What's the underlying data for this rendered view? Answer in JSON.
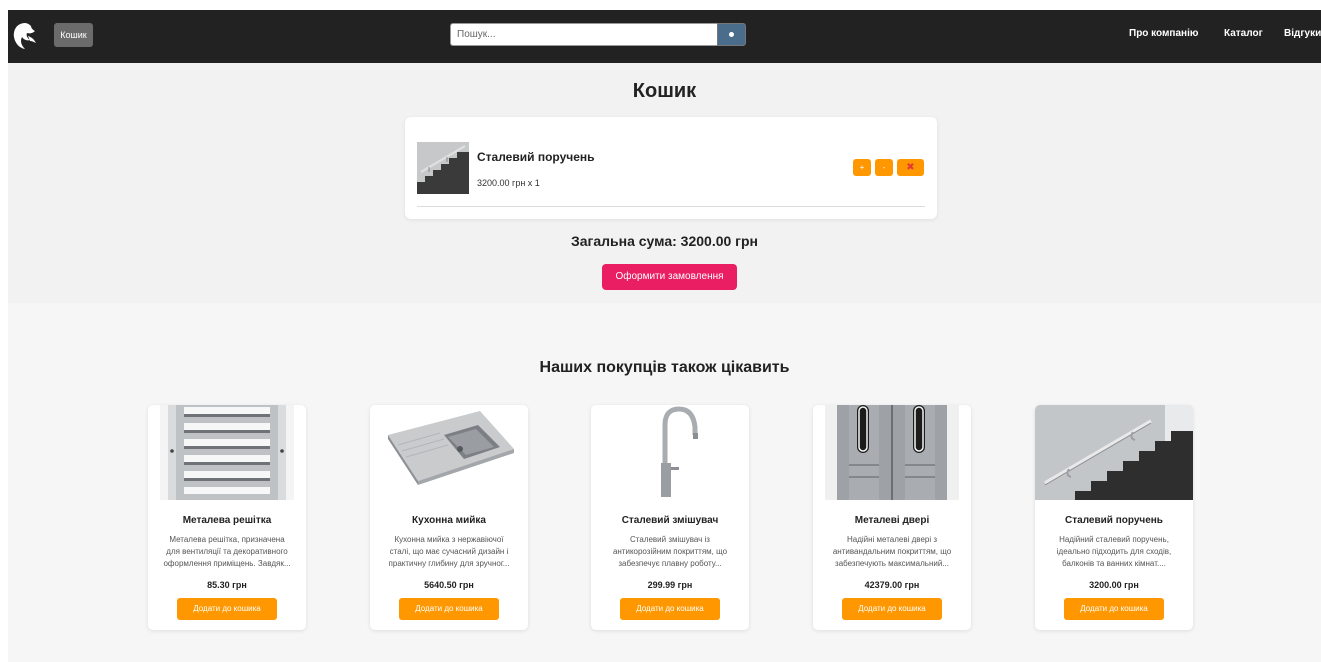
{
  "header": {
    "cart_button": "Кошик",
    "search_placeholder": "Пошук...",
    "nav": [
      "Про компанію",
      "Каталог",
      "Відгуки"
    ]
  },
  "cart": {
    "title": "Кошик",
    "items": [
      {
        "name": "Сталевий поручень",
        "price_line": "3200.00 грн x 1",
        "plus": "+",
        "minus": "-",
        "remove": "✖"
      }
    ],
    "total": "Загальна сума: 3200.00 грн",
    "order_button": "Оформити замовлення"
  },
  "recommendations": {
    "title": "Наших покупців також цікавить",
    "add_label": "Додати до кошика",
    "products": [
      {
        "name": "Металева решітка",
        "desc": "Металева решітка, призначена для вентиляції та декоративного оформлення приміщень. Завдяк...",
        "price": "85.30 грн"
      },
      {
        "name": "Кухонна мийка",
        "desc": "Кухонна мийка з нержавіючої сталі, що має сучасний дизайн і практичну глибину для зручног...",
        "price": "5640.50 грн"
      },
      {
        "name": "Сталевий змішувач",
        "desc": "Сталевий змішувач із антикорозійним покриттям, що забезпечує плавну роботу...",
        "price": "299.99 грн"
      },
      {
        "name": "Металеві двері",
        "desc": "Надійні металеві двері з антивандальним покриттям, що забезпечують максимальний...",
        "price": "42379.00 грн"
      },
      {
        "name": "Сталевий поручень",
        "desc": "Надійний сталевий поручень, ідеально підходить для сходів, балконів та ванних кімнат....",
        "price": "3200.00 грн"
      }
    ]
  },
  "colors": {
    "header_bg": "#222222",
    "accent_orange": "#ff9800",
    "order_pink": "#e91e63"
  }
}
